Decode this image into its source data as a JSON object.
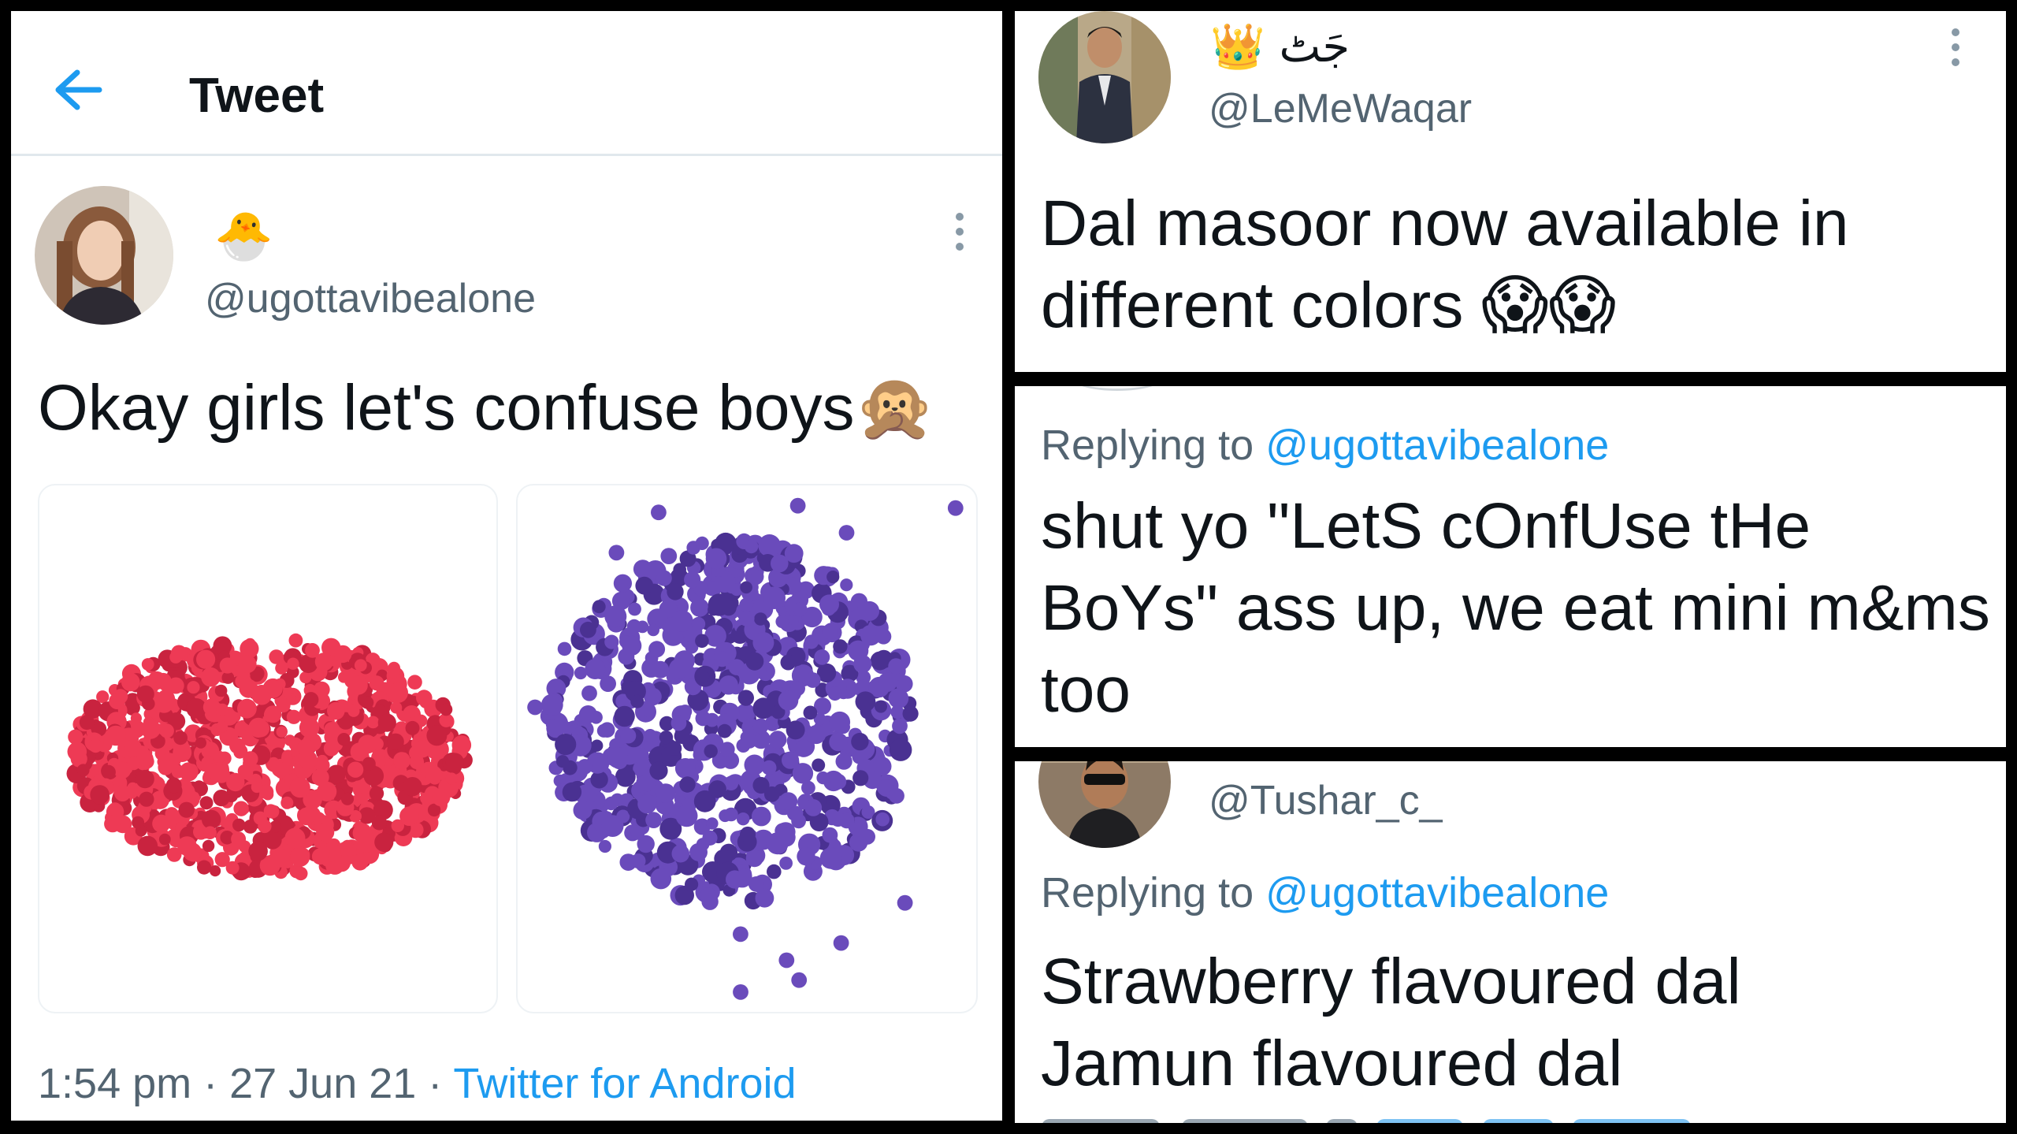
{
  "tweet": {
    "header_title": "Tweet",
    "author_emoji": "🐣",
    "author_handle": "@ugottavibealone",
    "text": "Okay girls let's confuse boys🙊",
    "timestamp": "1:54 pm · 27 Jun 21 · ",
    "source": "Twitter for Android",
    "media": [
      {
        "description": "red wax beads",
        "color": "#e8334f"
      },
      {
        "description": "purple wax beads",
        "color": "#5b3fa6"
      }
    ]
  },
  "reply_1": {
    "author_name": "👑 جَٹ",
    "author_handle": "@LeMeWaqar",
    "text": "Dal masoor now available in different colors 😱😱"
  },
  "reply_2": {
    "replying_prefix": "Replying to ",
    "replying_handle": "@ugottavibealone",
    "text": "shut yo \"LetS cOnfUse tHe BoYs\" ass up, we eat mini m&ms too"
  },
  "reply_3": {
    "author_handle": "@Tushar_c_",
    "replying_prefix": "Replying to ",
    "replying_handle": "@ugottavibealone",
    "line_1": "Strawberry flavoured dal",
    "line_2": "Jamun flavoured dal"
  },
  "colors": {
    "link": "#1d9bf0",
    "secondary_text": "#536471",
    "primary_text": "#0f1419"
  }
}
